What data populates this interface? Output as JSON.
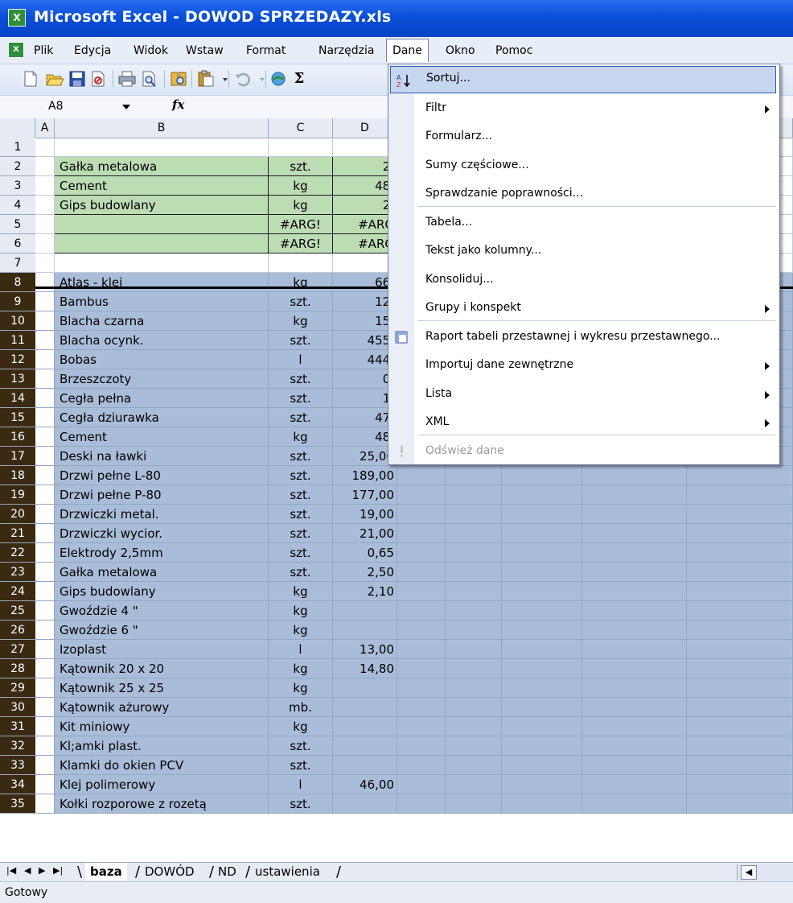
{
  "window": {
    "title": "Microsoft Excel - DOWOD SPRZEDAZY.xls"
  },
  "menubar": {
    "items": [
      "Plik",
      "Edycja",
      "Widok",
      "Wstaw",
      "Format",
      "Narzędzia",
      "Dane",
      "Okno",
      "Pomoc"
    ],
    "active": "Dane"
  },
  "toolbar": {
    "icons": [
      "new-icon",
      "open-icon",
      "save-icon",
      "permission-icon",
      "print-icon",
      "print-preview-icon",
      "research-icon",
      "paste-icon",
      "undo-icon",
      "hyperlink-icon",
      "autosum-icon"
    ],
    "sigma": "Σ"
  },
  "formula_bar": {
    "name_box": "A8",
    "fx": "fx",
    "content": ""
  },
  "columns": [
    "A",
    "B",
    "C",
    "D"
  ],
  "green_rows": [
    {
      "row": "1",
      "name": "",
      "unit": "",
      "value": ""
    },
    {
      "row": "2",
      "name": "Gałka  metalowa",
      "unit": "szt.",
      "value": "2,"
    },
    {
      "row": "3",
      "name": "Cement",
      "unit": "kg",
      "value": "48,"
    },
    {
      "row": "4",
      "name": "Gips budowlany",
      "unit": "kg",
      "value": "2,"
    },
    {
      "row": "5",
      "name": "",
      "unit": "#ARG!",
      "value": "#ARG"
    },
    {
      "row": "6",
      "name": "",
      "unit": "#ARG!",
      "value": "#ARG"
    },
    {
      "row": "7",
      "name": "",
      "unit": "",
      "value": ""
    }
  ],
  "rows": [
    {
      "row": "8",
      "name": "Atlas - klej",
      "unit": "kg",
      "value": "66,"
    },
    {
      "row": "9",
      "name": "Bambus",
      "unit": "szt.",
      "value": "12,"
    },
    {
      "row": "10",
      "name": "Blacha  czarna",
      "unit": "kg",
      "value": "15,"
    },
    {
      "row": "11",
      "name": "Blacha ocynk.",
      "unit": "szt.",
      "value": "455,"
    },
    {
      "row": "12",
      "name": "Bobas",
      "unit": "l",
      "value": "444,"
    },
    {
      "row": "13",
      "name": "Brzeszczoty",
      "unit": "szt.",
      "value": "0,"
    },
    {
      "row": "14",
      "name": "Cegła  pełna",
      "unit": "szt.",
      "value": "1,"
    },
    {
      "row": "15",
      "name": "Cegła  dziurawka",
      "unit": "szt.",
      "value": "47,"
    },
    {
      "row": "16",
      "name": "Cement",
      "unit": "kg",
      "value": "48,"
    },
    {
      "row": "17",
      "name": "Deski na ławki",
      "unit": "szt.",
      "value": "25,00"
    },
    {
      "row": "18",
      "name": "Drzwi pełne L-80",
      "unit": "szt.",
      "value": "189,00"
    },
    {
      "row": "19",
      "name": "Drzwi pełne P-80",
      "unit": "szt.",
      "value": "177,00"
    },
    {
      "row": "20",
      "name": "Drzwiczki metal.",
      "unit": "szt.",
      "value": "19,00"
    },
    {
      "row": "21",
      "name": "Drzwiczki wycior.",
      "unit": "szt.",
      "value": "21,00"
    },
    {
      "row": "22",
      "name": "Elektrody  2,5mm",
      "unit": "szt.",
      "value": "0,65"
    },
    {
      "row": "23",
      "name": "Gałka  metalowa",
      "unit": "szt.",
      "value": "2,50"
    },
    {
      "row": "24",
      "name": "Gips budowlany",
      "unit": "kg",
      "value": "2,10"
    },
    {
      "row": "25",
      "name": "Gwoździe  4 \"",
      "unit": "kg",
      "value": ""
    },
    {
      "row": "26",
      "name": "Gwoździe 6 \"",
      "unit": "kg",
      "value": ""
    },
    {
      "row": "27",
      "name": "Izoplast",
      "unit": "l",
      "value": "13,00"
    },
    {
      "row": "28",
      "name": "Kątownik  20 x 20",
      "unit": "kg",
      "value": "14,80"
    },
    {
      "row": "29",
      "name": "Kątownik  25 x 25",
      "unit": "kg",
      "value": ""
    },
    {
      "row": "30",
      "name": "Kątownik ażurowy",
      "unit": "mb.",
      "value": ""
    },
    {
      "row": "31",
      "name": "Kit  miniowy",
      "unit": "kg",
      "value": ""
    },
    {
      "row": "32",
      "name": "Kl;amki plast.",
      "unit": "szt.",
      "value": ""
    },
    {
      "row": "33",
      "name": "Klamki do okien PCV",
      "unit": "szt.",
      "value": ""
    },
    {
      "row": "34",
      "name": "Klej polimerowy",
      "unit": "l",
      "value": "46,00"
    },
    {
      "row": "35",
      "name": "Kołki rozporowe z rozetą",
      "unit": "szt.",
      "value": ""
    }
  ],
  "sheet_tabs": [
    "baza",
    "DOWÓD",
    "ND",
    "ustawienia"
  ],
  "active_sheet": "baza",
  "status": "Gotowy",
  "dane_menu": [
    {
      "label": "Sortuj...",
      "submenu": false,
      "enabled": true
    },
    {
      "label": "Filtr",
      "submenu": true,
      "enabled": true
    },
    {
      "label": "Formularz...",
      "submenu": false,
      "enabled": true
    },
    {
      "label": "Sumy częściowe...",
      "submenu": false,
      "enabled": true
    },
    {
      "label": "Sprawdzanie poprawności...",
      "submenu": false,
      "enabled": true
    },
    {
      "label": "Tabela...",
      "submenu": false,
      "enabled": true
    },
    {
      "label": "Tekst jako kolumny...",
      "submenu": false,
      "enabled": true
    },
    {
      "label": "Konsoliduj...",
      "submenu": false,
      "enabled": true
    },
    {
      "label": "Grupy i konspekt",
      "submenu": true,
      "enabled": true
    },
    {
      "label": "Raport tabeli przestawnej i wykresu przestawnego...",
      "submenu": false,
      "enabled": true
    },
    {
      "label": "Importuj dane zewnętrzne",
      "submenu": true,
      "enabled": true
    },
    {
      "label": "Lista",
      "submenu": true,
      "enabled": true
    },
    {
      "label": "XML",
      "submenu": true,
      "enabled": true
    },
    {
      "label": "Odśwież dane",
      "submenu": false,
      "enabled": false
    }
  ],
  "colors": {
    "title_bar": "#0a4fd8",
    "selection": "#a9bdd8",
    "green_block": "#bcdcb4",
    "menu_highlight": "#c6d6ef",
    "selected_row_header": "#3a2a12"
  }
}
